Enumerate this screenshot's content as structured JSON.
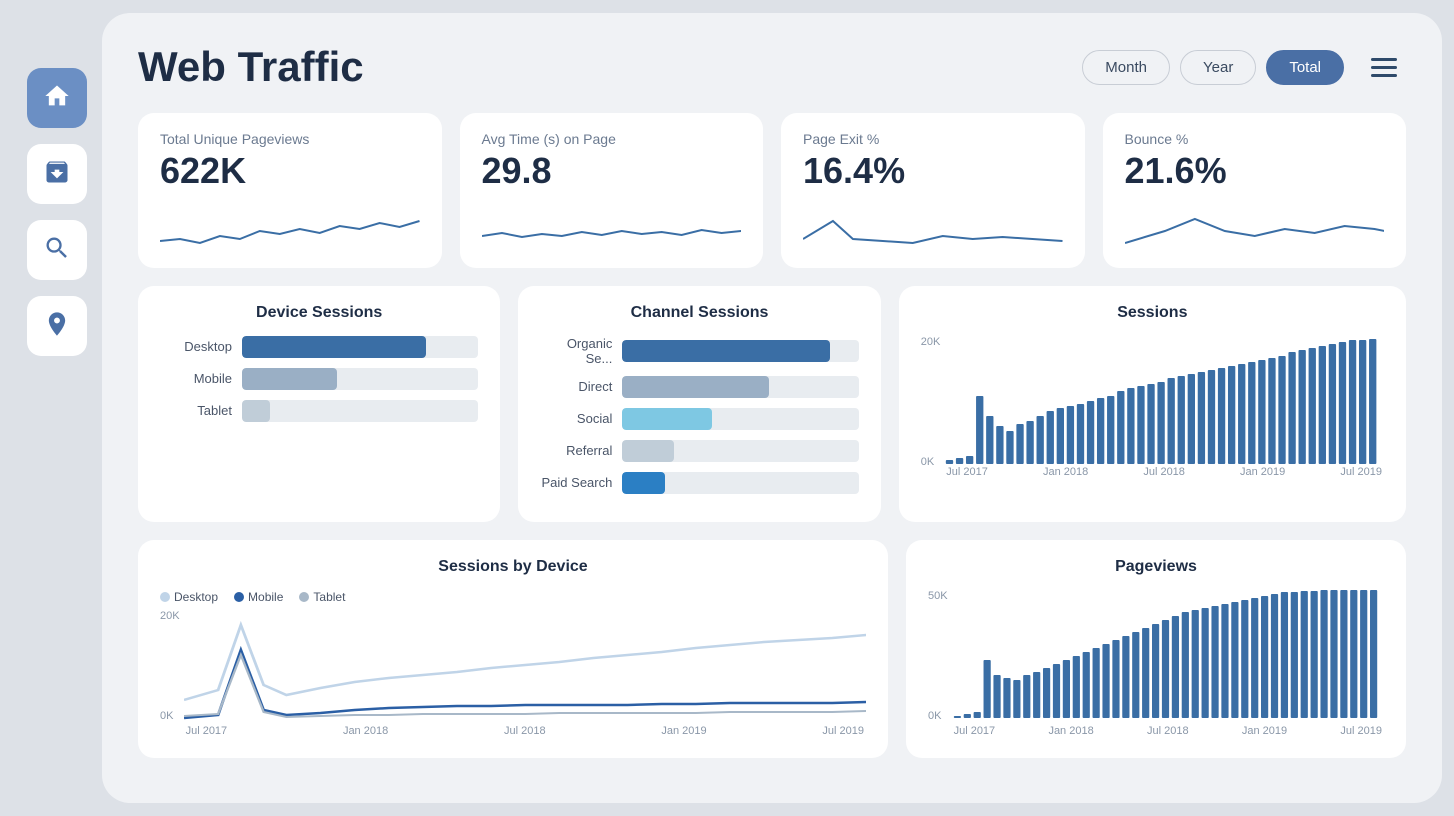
{
  "header": {
    "title": "Web Traffic",
    "controls": {
      "month_label": "Month",
      "year_label": "Year",
      "total_label": "Total",
      "active_period": "Total"
    }
  },
  "sidebar": {
    "items": [
      {
        "name": "home",
        "active": true
      },
      {
        "name": "archive",
        "active": false
      },
      {
        "name": "search",
        "active": false
      },
      {
        "name": "location",
        "active": false
      }
    ]
  },
  "kpis": [
    {
      "label": "Total Unique Pageviews",
      "value": "622K"
    },
    {
      "label": "Avg Time (s) on Page",
      "value": "29.8"
    },
    {
      "label": "Page Exit %",
      "value": "16.4%"
    },
    {
      "label": "Bounce %",
      "value": "21.6%"
    }
  ],
  "device_sessions": {
    "title": "Device Sessions",
    "items": [
      {
        "label": "Desktop",
        "pct": 78,
        "color": "dark-blue"
      },
      {
        "label": "Mobile",
        "pct": 40,
        "color": "gray"
      },
      {
        "label": "Tablet",
        "pct": 12,
        "color": "light-gray"
      }
    ]
  },
  "channel_sessions": {
    "title": "Channel Sessions",
    "items": [
      {
        "label": "Organic Se...",
        "pct": 88,
        "color": "dark-blue"
      },
      {
        "label": "Direct",
        "pct": 62,
        "color": "gray"
      },
      {
        "label": "Social",
        "pct": 38,
        "color": "light-blue"
      },
      {
        "label": "Referral",
        "pct": 22,
        "color": "light-gray"
      },
      {
        "label": "Paid Search",
        "pct": 18,
        "color": "blue-bright"
      }
    ]
  },
  "sessions": {
    "title": "Sessions",
    "y_labels": [
      "20K",
      "0K"
    ],
    "x_labels": [
      "Jul 2017",
      "Jan 2018",
      "Jul 2018",
      "Jan 2019",
      "Jul 2019"
    ]
  },
  "sessions_by_device": {
    "title": "Sessions by Device",
    "legend": [
      {
        "label": "Desktop",
        "color": "#c0d4e8"
      },
      {
        "label": "Mobile",
        "color": "#2b5fa5"
      },
      {
        "label": "Tablet",
        "color": "#a8b8c8"
      }
    ],
    "y_labels": [
      "20K",
      "0K"
    ],
    "x_labels": [
      "Jul 2017",
      "Jan 2018",
      "Jul 2018",
      "Jan 2019",
      "Jul 2019"
    ]
  },
  "pageviews": {
    "title": "Pageviews",
    "y_labels": [
      "50K",
      "0K"
    ],
    "x_labels": [
      "Jul 2017",
      "Jan 2018",
      "Jul 2018",
      "Jan 2019",
      "Jul 2019"
    ]
  }
}
